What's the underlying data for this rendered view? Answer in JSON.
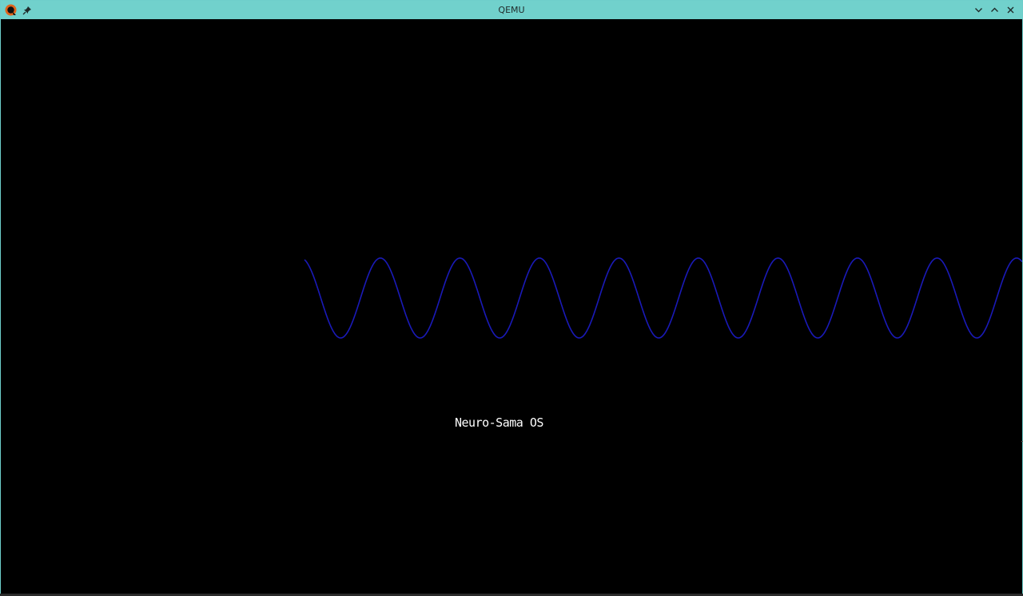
{
  "window": {
    "title": "QEMU",
    "titlebar_color": "#71d1cc"
  },
  "titlebar": {
    "app_icon": "qemu-logo-icon",
    "pin_icon": "pin-icon",
    "controls": [
      "chevron-down-icon",
      "chevron-up-icon",
      "close-icon"
    ]
  },
  "screen": {
    "background": "#000000",
    "os_name": "Neuro-Sama OS",
    "wave_color": "#1a1ab8"
  }
}
